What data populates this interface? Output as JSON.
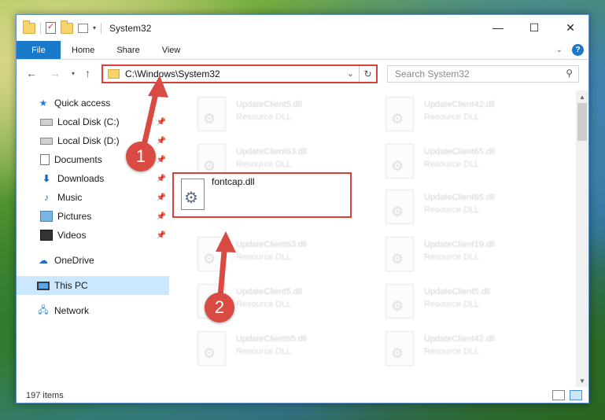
{
  "window": {
    "title": "System32"
  },
  "controls": {
    "minimize": "—",
    "maximize": "☐",
    "close": "✕"
  },
  "ribbon": {
    "file": "File",
    "tabs": [
      "Home",
      "Share",
      "View"
    ],
    "help": "?"
  },
  "nav": {
    "address": "C:\\Windows\\System32",
    "search_placeholder": "Search System32"
  },
  "sidebar": {
    "items": [
      {
        "label": "Quick access",
        "icon": "star-icon"
      },
      {
        "label": "Local Disk (C:)",
        "icon": "disk-icon",
        "pinned": true
      },
      {
        "label": "Local Disk (D:)",
        "icon": "disk-icon",
        "pinned": true
      },
      {
        "label": "Documents",
        "icon": "document-icon",
        "pinned": true
      },
      {
        "label": "Downloads",
        "icon": "download-icon",
        "pinned": true
      },
      {
        "label": "Music",
        "icon": "music-icon",
        "pinned": true
      },
      {
        "label": "Pictures",
        "icon": "pictures-icon",
        "pinned": true
      },
      {
        "label": "Videos",
        "icon": "videos-icon",
        "pinned": true
      },
      {
        "label": "OneDrive",
        "icon": "cloud-icon"
      },
      {
        "label": "This PC",
        "icon": "pc-icon",
        "selected": true
      },
      {
        "label": "Network",
        "icon": "network-icon"
      }
    ]
  },
  "files": {
    "left": [
      {
        "name": "UpdateClient5.dll",
        "type": "Resource DLL"
      },
      {
        "name": "UpdateClient63.dll",
        "type": "Resource DLL"
      },
      {
        "name": "fontcap.dll",
        "type": ""
      },
      {
        "name": "UpdateClient63.dll",
        "type": "Resource DLL"
      },
      {
        "name": "UpdateClient5.dll",
        "type": "Resource DLL"
      },
      {
        "name": "UpdateClient65.dll",
        "type": "Resource DLL"
      }
    ],
    "right": [
      {
        "name": "UpdateClient42.dll",
        "type": "Resource DLL"
      },
      {
        "name": "UpdateClient65.dll",
        "type": "Resource DLL"
      },
      {
        "name": "UpdateClient65.dll",
        "type": "Resource DLL"
      },
      {
        "name": "UpdateClient19.dll",
        "type": "Resource DLL"
      },
      {
        "name": "UpdateClient5.dll",
        "type": "Resource DLL"
      },
      {
        "name": "UpdateClient42.dll",
        "type": "Resource DLL"
      }
    ]
  },
  "status": {
    "count": "197 items"
  },
  "annotations": {
    "step1": "1",
    "step2": "2"
  },
  "colors": {
    "accent": "#1979ca",
    "highlight": "#d9403b"
  }
}
